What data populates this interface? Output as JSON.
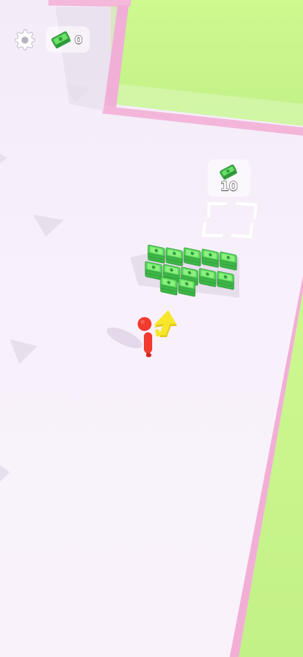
{
  "hud": {
    "money_count": "0",
    "settings_icon": "gear-icon",
    "money_icon": "cash-stack-icon"
  },
  "unlock_zone": {
    "price": "10",
    "icon": "cash-stack-icon"
  },
  "world": {
    "floor_color": "#f6eefa",
    "wall_color": "#f0a8cf",
    "grass_color": "#c9f78f",
    "cash_color": "#57d65a",
    "player_color": "#f23a2f",
    "arrow_color": "#f7e62a",
    "cash_stacks_visible": 12
  }
}
